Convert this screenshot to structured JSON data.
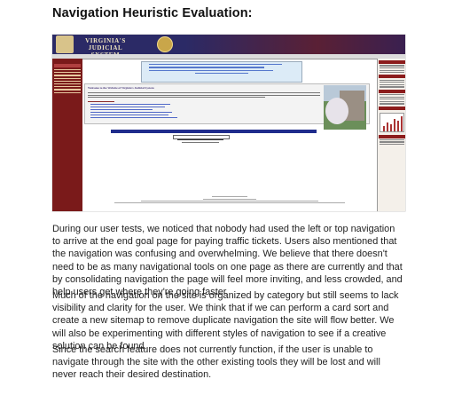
{
  "heading": "Navigation Heuristic Evaluation:",
  "screenshot": {
    "logo_line1": "VIRGINIA'S",
    "logo_line2": "JUDICIAL SYSTEM",
    "welcome_title": "Welcome to the Website of Virginia's Judicial System",
    "colors": {
      "banner": "#2b2a66",
      "left_nav": "#7a1a1a",
      "announcement": "#dcebf7",
      "nav_bar": "#1f2c8c"
    }
  },
  "paragraphs": [
    "During our user tests, we noticed that nobody had used the left or top navigation to arrive at the end goal page for paying traffic tickets. Users also mentioned that the navigation was confusing and overwhelming. We believe that there doesn't need to be as many navigational tools on one page as there are currently and that by consolidating navigation the page will feel more inviting, and less crowded, and help users get where they're going faster.",
    "Much of the navigation on the site is organized by category but still seems to lack visibility and clarity for the user. We think that if we can perform a card sort and create a new sitemap to remove duplicate navigation the site will flow better. We will also be experimenting with different styles of navigation to see if a creative solution can be found.",
    "Since the search feature does not currently function, if the user is unable to navigate through the site with the other existing tools they will be lost and will never reach their desired destination."
  ]
}
